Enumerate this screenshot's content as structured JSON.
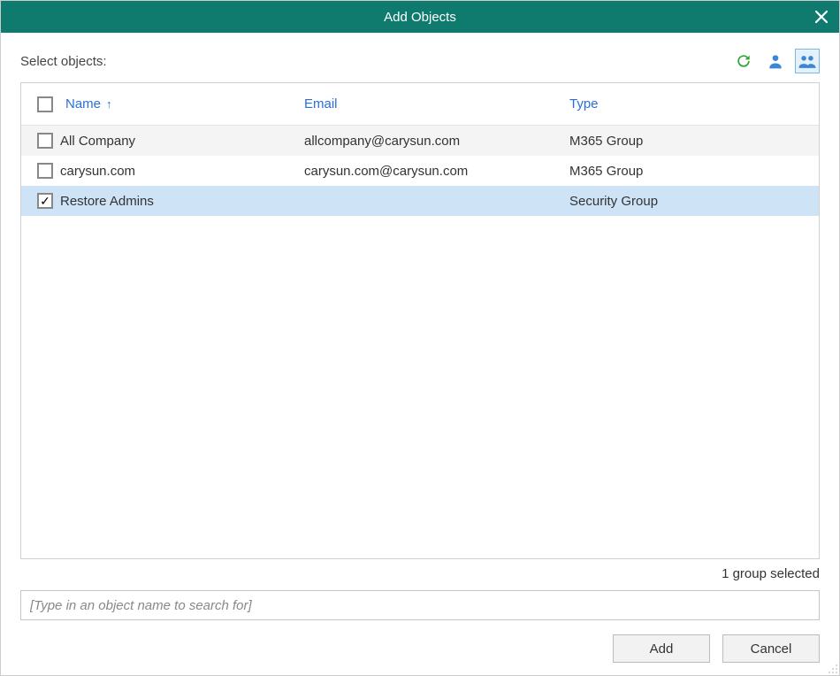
{
  "dialog": {
    "title": "Add Objects",
    "label": "Select objects:"
  },
  "toolbar": {
    "refresh_icon": "refresh",
    "user_icon": "user",
    "group_icon": "group",
    "active_view": "group"
  },
  "table": {
    "headers": {
      "name": "Name",
      "email": "Email",
      "type": "Type"
    },
    "sort": {
      "column": "name",
      "dir": "asc"
    },
    "rows": [
      {
        "checked": false,
        "name": "All Company",
        "email": "allcompany@carysun.com",
        "type": "M365 Group"
      },
      {
        "checked": false,
        "name": "carysun.com",
        "email": "carysun.com@carysun.com",
        "type": "M365 Group"
      },
      {
        "checked": true,
        "name": "Restore Admins",
        "email": "",
        "type": "Security Group"
      }
    ]
  },
  "status": "1 group selected",
  "search": {
    "placeholder": "Type in an object name to search for",
    "value": ""
  },
  "buttons": {
    "add": "Add",
    "cancel": "Cancel"
  }
}
